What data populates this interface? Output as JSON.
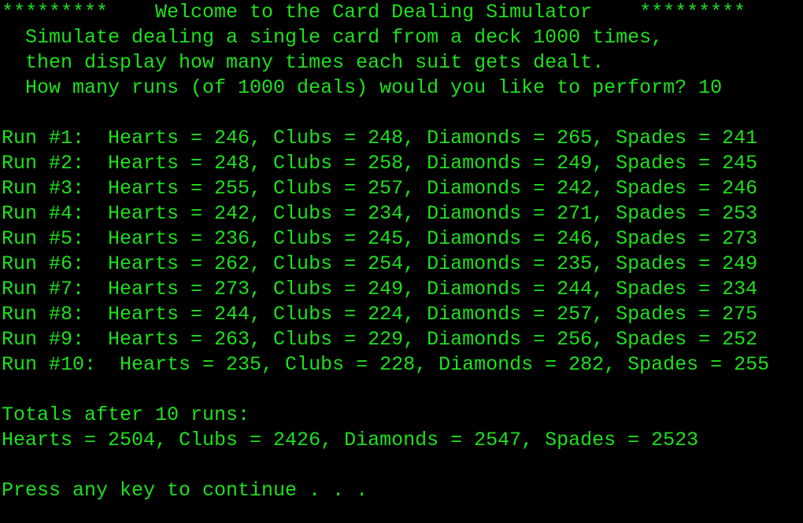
{
  "theme": {
    "background": "#000000",
    "text_color": "#1ee01e"
  },
  "console": {
    "lines": [
      "*********    Welcome to the Card Dealing Simulator    *********",
      "  Simulate dealing a single card from a deck 1000 times,",
      "  then display how many times each suit gets dealt.",
      "  How many runs (of 1000 deals) would you like to perform? 10",
      "",
      "Run #1:  Hearts = 246, Clubs = 248, Diamonds = 265, Spades = 241",
      "Run #2:  Hearts = 248, Clubs = 258, Diamonds = 249, Spades = 245",
      "Run #3:  Hearts = 255, Clubs = 257, Diamonds = 242, Spades = 246",
      "Run #4:  Hearts = 242, Clubs = 234, Diamonds = 271, Spades = 253",
      "Run #5:  Hearts = 236, Clubs = 245, Diamonds = 246, Spades = 273",
      "Run #6:  Hearts = 262, Clubs = 254, Diamonds = 235, Spades = 249",
      "Run #7:  Hearts = 273, Clubs = 249, Diamonds = 244, Spades = 234",
      "Run #8:  Hearts = 244, Clubs = 224, Diamonds = 257, Spades = 275",
      "Run #9:  Hearts = 263, Clubs = 229, Diamonds = 256, Spades = 252",
      "Run #10:  Hearts = 235, Clubs = 228, Diamonds = 282, Spades = 255",
      "",
      "Totals after 10 runs:",
      "Hearts = 2504, Clubs = 2426, Diamonds = 2547, Spades = 2523",
      "",
      "Press any key to continue . . ."
    ]
  }
}
